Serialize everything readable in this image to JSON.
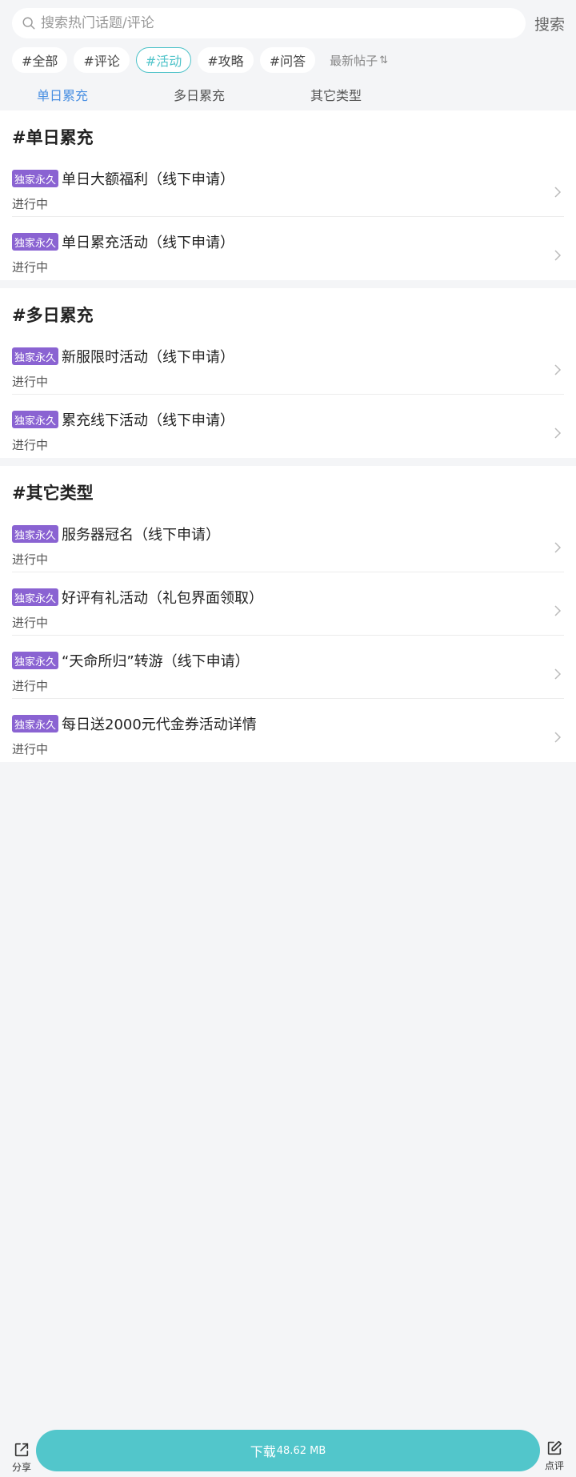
{
  "search": {
    "placeholder": "搜索热门话题/评论",
    "button_label": "搜索"
  },
  "tags": [
    {
      "label": "#全部",
      "active": false
    },
    {
      "label": "#评论",
      "active": false
    },
    {
      "label": "#活动",
      "active": true
    },
    {
      "label": "#攻略",
      "active": false
    },
    {
      "label": "#问答",
      "active": false
    }
  ],
  "sort": {
    "label": "最新帖子",
    "icon": "sort-arrows-icon"
  },
  "subtabs": [
    {
      "label": "单日累充",
      "active": true
    },
    {
      "label": "多日累充",
      "active": false
    },
    {
      "label": "其它类型",
      "active": false
    }
  ],
  "sections": [
    {
      "title": "#单日累充",
      "items": [
        {
          "badge": "独家永久",
          "title": "单日大额福利（线下申请）",
          "status": "进行中"
        },
        {
          "badge": "独家永久",
          "title": "单日累充活动（线下申请）",
          "status": "进行中"
        }
      ]
    },
    {
      "title": "#多日累充",
      "items": [
        {
          "badge": "独家永久",
          "title": "新服限时活动（线下申请）",
          "status": "进行中"
        },
        {
          "badge": "独家永久",
          "title": "累充线下活动（线下申请）",
          "status": "进行中"
        }
      ]
    },
    {
      "title": "#其它类型",
      "items": [
        {
          "badge": "独家永久",
          "title": "服务器冠名（线下申请）",
          "status": "进行中"
        },
        {
          "badge": "独家永久",
          "title": "好评有礼活动（礼包界面领取）",
          "status": "进行中"
        },
        {
          "badge": "独家永久",
          "title": "“天命所归”转游（线下申请）",
          "status": "进行中"
        },
        {
          "badge": "独家永久",
          "title": "每日送2000元代金券活动详情",
          "status": "进行中"
        }
      ]
    }
  ],
  "bottom": {
    "share_label": "分享",
    "download_label": "下载",
    "download_size": "48.62 MB",
    "review_label": "点评"
  },
  "colors": {
    "accent": "#52c6cb",
    "active_tab": "#4a90e2",
    "badge": "#8a63d2",
    "background": "#f4f5f7"
  }
}
